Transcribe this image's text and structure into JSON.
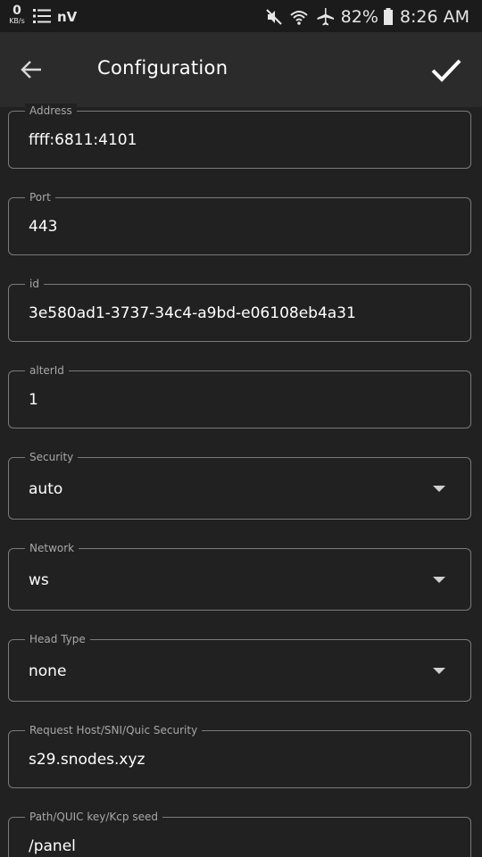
{
  "status_bar": {
    "speed_value": "0",
    "speed_unit": "KB/s",
    "app_label": "nV",
    "battery": "82%",
    "time": "8:26 AM",
    "icons": [
      "network-speed",
      "list-icon",
      "mute-icon",
      "wifi-icon",
      "airplane-icon",
      "battery-icon"
    ]
  },
  "app_bar": {
    "title": "Configuration",
    "back_icon": "arrow-back-icon",
    "save_icon": "check-icon"
  },
  "fields": {
    "address": {
      "label": "Address",
      "value": "ffff:6811:4101"
    },
    "port": {
      "label": "Port",
      "value": "443"
    },
    "id": {
      "label": "id",
      "value": "3e580ad1-3737-34c4-a9bd-e06108eb4a31"
    },
    "alter_id": {
      "label": "alterId",
      "value": "1"
    },
    "security": {
      "label": "Security",
      "value": "auto",
      "type": "dropdown"
    },
    "network": {
      "label": "Network",
      "value": "ws",
      "type": "dropdown"
    },
    "head_type": {
      "label": "Head Type",
      "value": "none",
      "type": "dropdown"
    },
    "request_host": {
      "label": "Request Host/SNI/Quic Security",
      "value": "s29.snodes.xyz"
    },
    "path": {
      "label": "Path/QUIC key/Kcp seed",
      "value": "/panel"
    }
  },
  "colors": {
    "background": "#212121",
    "app_bar": "#2b2b2b",
    "status_bar": "#1b1b1b",
    "field_border": "#7a7a7a",
    "label_text": "#a8a8a8",
    "value_text": "#ffffff"
  }
}
